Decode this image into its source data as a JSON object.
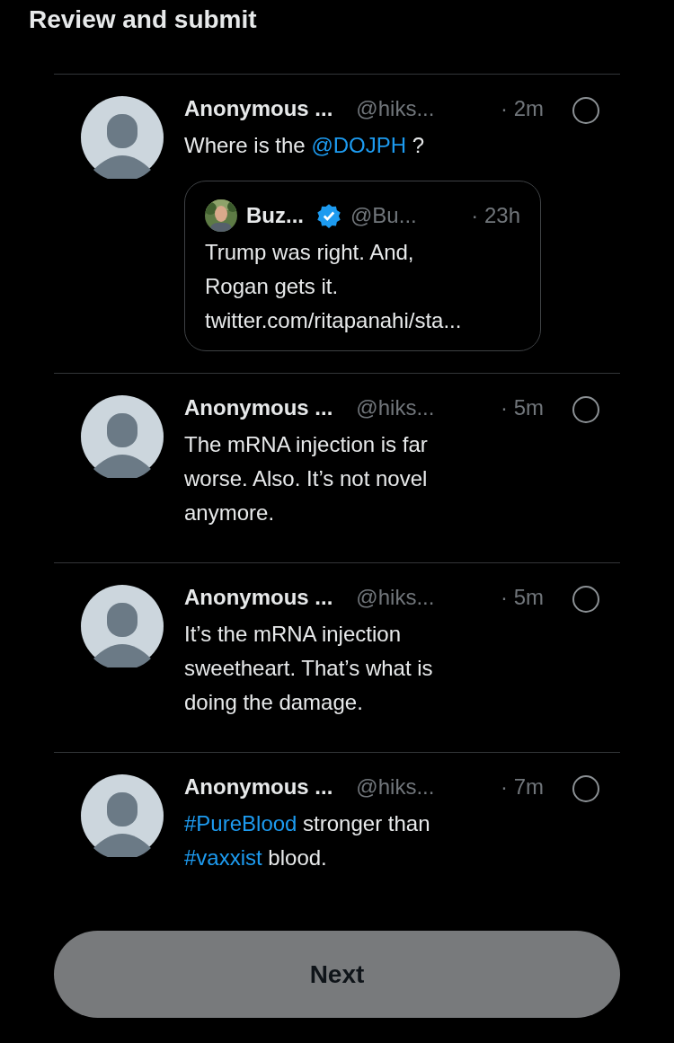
{
  "title": "Review and submit",
  "tweets": [
    {
      "name": "Anonymous ...",
      "handle": "@hiks...",
      "time": "· 2m",
      "selected": false,
      "body": [
        {
          "kind": "text",
          "text": "Where is the "
        },
        {
          "kind": "link",
          "text": "@DOJPH"
        },
        {
          "kind": "text",
          "text": " ?"
        }
      ],
      "quote": {
        "name": "Buz...",
        "verified": true,
        "handle": "@Bu...",
        "time": "· 23h",
        "body": "Trump was right. And, Rogan gets it. twitter.com/ritapanahi/sta..."
      }
    },
    {
      "name": "Anonymous ...",
      "handle": "@hiks...",
      "time": "· 5m",
      "selected": false,
      "body": [
        {
          "kind": "text",
          "text": "The mRNA injection is far worse. Also. It’s not novel anymore."
        }
      ]
    },
    {
      "name": "Anonymous ...",
      "handle": "@hiks...",
      "time": "· 5m",
      "selected": false,
      "body": [
        {
          "kind": "text",
          "text": "It’s the mRNA injection sweetheart. That’s what is doing the damage."
        }
      ]
    },
    {
      "name": "Anonymous ...",
      "handle": "@hiks...",
      "time": "· 7m",
      "selected": false,
      "body": [
        {
          "kind": "link",
          "text": "#PureBlood"
        },
        {
          "kind": "text",
          "text": " stronger than "
        },
        {
          "kind": "link",
          "text": "#vaxxist"
        },
        {
          "kind": "text",
          "text": " blood."
        }
      ]
    }
  ],
  "button": "Next"
}
